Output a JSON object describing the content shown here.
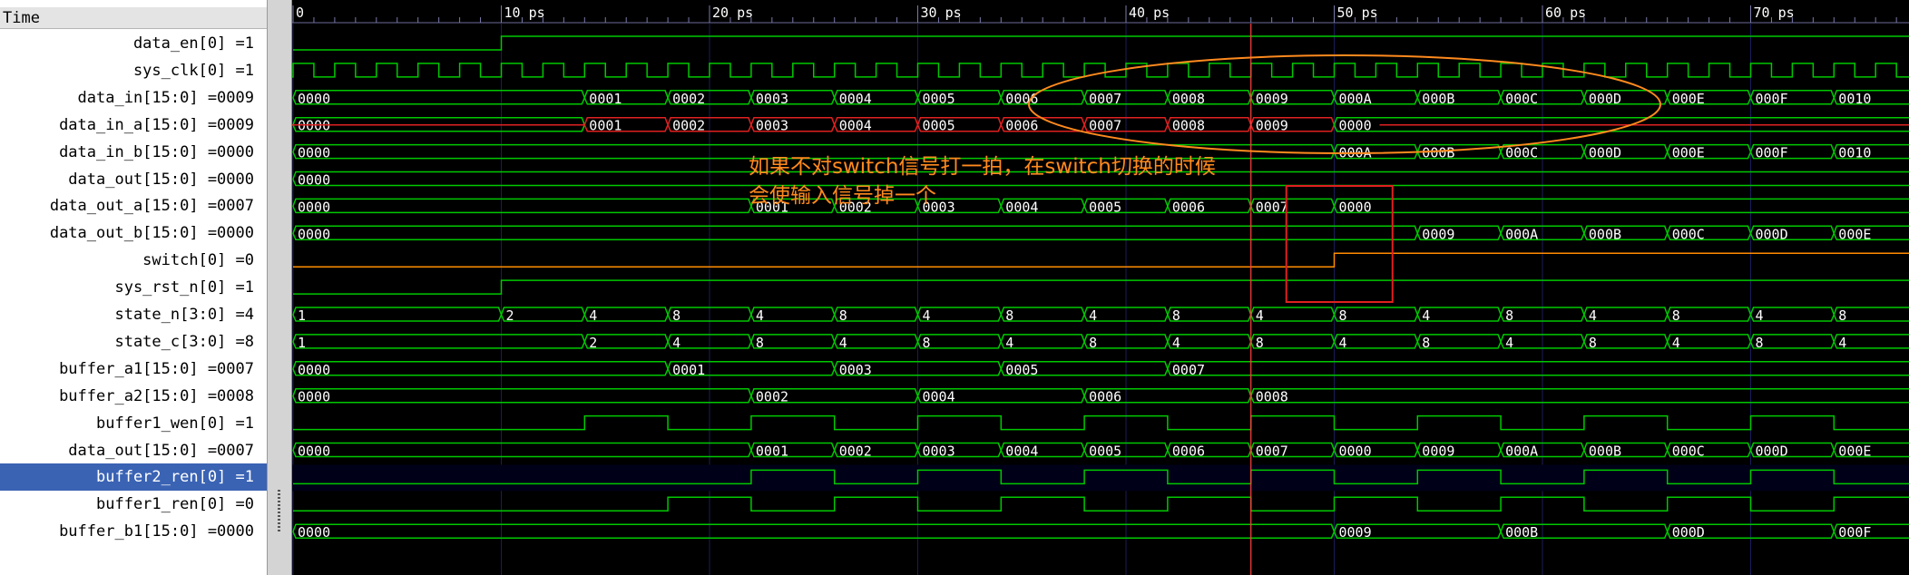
{
  "header": {
    "time_label": "Time"
  },
  "timescale": {
    "ticks": [
      {
        "value": 0,
        "label": "0"
      },
      {
        "value": 10,
        "label": "10 ps"
      },
      {
        "value": 20,
        "label": "20 ps"
      },
      {
        "value": 30,
        "label": "30 ps"
      },
      {
        "value": 40,
        "label": "40 ps"
      },
      {
        "value": 50,
        "label": "50 ps"
      },
      {
        "value": 60,
        "label": "60 ps"
      },
      {
        "value": 70,
        "label": "70 ps"
      }
    ],
    "cursor_time": 46
  },
  "colors": {
    "trace": "#00c800",
    "red_trace": "#e02020",
    "switch_trace": "#ff8c00",
    "cursor": "#ff4040",
    "annotation": "#ff8a1e",
    "selected_row": "#3a63b4"
  },
  "signals": [
    {
      "label": "data_en[0] =1",
      "kind": "bit",
      "transitions": [
        [
          0,
          0
        ],
        [
          10,
          1
        ]
      ]
    },
    {
      "label": "sys_clk[0] =1",
      "kind": "clock",
      "half_period": 1
    },
    {
      "label": "data_in[15:0] =0009",
      "kind": "bus",
      "segments": [
        [
          0,
          "0000"
        ],
        [
          14,
          "0001"
        ],
        [
          18,
          "0002"
        ],
        [
          22,
          "0003"
        ],
        [
          26,
          "0004"
        ],
        [
          30,
          "0005"
        ],
        [
          34,
          "0006"
        ],
        [
          38,
          "0007"
        ],
        [
          42,
          "0008"
        ],
        [
          46,
          "0009"
        ],
        [
          50,
          "000A"
        ],
        [
          54,
          "000B"
        ],
        [
          58,
          "000C"
        ],
        [
          62,
          "000D"
        ],
        [
          66,
          "000E"
        ],
        [
          70,
          "000F"
        ],
        [
          74,
          "0010"
        ]
      ]
    },
    {
      "label": "data_in_a[15:0] =0009",
      "kind": "bus",
      "red_until": 50,
      "segments": [
        [
          0,
          "0000"
        ],
        [
          14,
          "0001"
        ],
        [
          18,
          "0002"
        ],
        [
          22,
          "0003"
        ],
        [
          26,
          "0004"
        ],
        [
          30,
          "0005"
        ],
        [
          34,
          "0006"
        ],
        [
          38,
          "0007"
        ],
        [
          42,
          "0008"
        ],
        [
          46,
          "0009"
        ],
        [
          50,
          "0000"
        ]
      ]
    },
    {
      "label": "data_in_b[15:0] =0000",
      "kind": "bus",
      "segments": [
        [
          0,
          "0000"
        ],
        [
          50,
          "000A"
        ],
        [
          54,
          "000B"
        ],
        [
          58,
          "000C"
        ],
        [
          62,
          "000D"
        ],
        [
          66,
          "000E"
        ],
        [
          70,
          "000F"
        ],
        [
          74,
          "0010"
        ]
      ]
    },
    {
      "label": "data_out[15:0] =0000",
      "kind": "bus",
      "segments": [
        [
          0,
          "0000"
        ]
      ]
    },
    {
      "label": "data_out_a[15:0] =0007",
      "kind": "bus",
      "segments": [
        [
          0,
          "0000"
        ],
        [
          22,
          "0001"
        ],
        [
          26,
          "0002"
        ],
        [
          30,
          "0003"
        ],
        [
          34,
          "0004"
        ],
        [
          38,
          "0005"
        ],
        [
          42,
          "0006"
        ],
        [
          46,
          "0007"
        ],
        [
          50,
          "0000"
        ]
      ]
    },
    {
      "label": "data_out_b[15:0] =0000",
      "kind": "bus",
      "segments": [
        [
          0,
          "0000"
        ],
        [
          54,
          "0009"
        ],
        [
          58,
          "000A"
        ],
        [
          62,
          "000B"
        ],
        [
          66,
          "000C"
        ],
        [
          70,
          "000D"
        ],
        [
          74,
          "000E"
        ]
      ]
    },
    {
      "label": "switch[0] =0",
      "kind": "bit",
      "orange": true,
      "transitions": [
        [
          0,
          0
        ],
        [
          50,
          1
        ]
      ]
    },
    {
      "label": "sys_rst_n[0] =1",
      "kind": "bit",
      "transitions": [
        [
          0,
          0
        ],
        [
          10,
          1
        ]
      ]
    },
    {
      "label": "state_n[3:0] =4",
      "kind": "bus",
      "segments": [
        [
          0,
          "1"
        ],
        [
          10,
          "2"
        ],
        [
          14,
          "4"
        ],
        [
          18,
          "8"
        ],
        [
          22,
          "4"
        ],
        [
          26,
          "8"
        ],
        [
          30,
          "4"
        ],
        [
          34,
          "8"
        ],
        [
          38,
          "4"
        ],
        [
          42,
          "8"
        ],
        [
          46,
          "4"
        ],
        [
          50,
          "8"
        ],
        [
          54,
          "4"
        ],
        [
          58,
          "8"
        ],
        [
          62,
          "4"
        ],
        [
          66,
          "8"
        ],
        [
          70,
          "4"
        ],
        [
          74,
          "8"
        ]
      ]
    },
    {
      "label": "state_c[3:0] =8",
      "kind": "bus",
      "segments": [
        [
          0,
          "1"
        ],
        [
          14,
          "2"
        ],
        [
          18,
          "4"
        ],
        [
          22,
          "8"
        ],
        [
          26,
          "4"
        ],
        [
          30,
          "8"
        ],
        [
          34,
          "4"
        ],
        [
          38,
          "8"
        ],
        [
          42,
          "4"
        ],
        [
          46,
          "8"
        ],
        [
          50,
          "4"
        ],
        [
          54,
          "8"
        ],
        [
          58,
          "4"
        ],
        [
          62,
          "8"
        ],
        [
          66,
          "4"
        ],
        [
          70,
          "8"
        ],
        [
          74,
          "4"
        ]
      ]
    },
    {
      "label": "buffer_a1[15:0] =0007",
      "kind": "bus",
      "segments": [
        [
          0,
          "0000"
        ],
        [
          18,
          "0001"
        ],
        [
          26,
          "0003"
        ],
        [
          34,
          "0005"
        ],
        [
          42,
          "0007"
        ]
      ]
    },
    {
      "label": "buffer_a2[15:0] =0008",
      "kind": "bus",
      "segments": [
        [
          0,
          "0000"
        ],
        [
          22,
          "0002"
        ],
        [
          30,
          "0004"
        ],
        [
          38,
          "0006"
        ],
        [
          46,
          "0008"
        ]
      ]
    },
    {
      "label": "buffer1_wen[0] =1",
      "kind": "bit",
      "transitions": [
        [
          0,
          0
        ],
        [
          14,
          1
        ],
        [
          18,
          0
        ],
        [
          22,
          1
        ],
        [
          26,
          0
        ],
        [
          30,
          1
        ],
        [
          34,
          0
        ],
        [
          38,
          1
        ],
        [
          42,
          0
        ],
        [
          46,
          1
        ],
        [
          50,
          0
        ],
        [
          54,
          1
        ],
        [
          58,
          0
        ],
        [
          62,
          1
        ],
        [
          66,
          0
        ],
        [
          70,
          1
        ],
        [
          74,
          0
        ]
      ]
    },
    {
      "label": "data_out[15:0] =0007",
      "kind": "bus",
      "segments": [
        [
          0,
          "0000"
        ],
        [
          22,
          "0001"
        ],
        [
          26,
          "0002"
        ],
        [
          30,
          "0003"
        ],
        [
          34,
          "0004"
        ],
        [
          38,
          "0005"
        ],
        [
          42,
          "0006"
        ],
        [
          46,
          "0007"
        ],
        [
          50,
          "0000"
        ],
        [
          54,
          "0009"
        ],
        [
          58,
          "000A"
        ],
        [
          62,
          "000B"
        ],
        [
          66,
          "000C"
        ],
        [
          70,
          "000D"
        ],
        [
          74,
          "000E"
        ]
      ]
    },
    {
      "label": "buffer2_ren[0] =1",
      "kind": "bit",
      "selected": true,
      "transitions": [
        [
          0,
          0
        ],
        [
          22,
          1
        ],
        [
          26,
          0
        ],
        [
          30,
          1
        ],
        [
          34,
          0
        ],
        [
          38,
          1
        ],
        [
          42,
          0
        ],
        [
          46,
          1
        ],
        [
          50,
          0
        ],
        [
          54,
          1
        ],
        [
          58,
          0
        ],
        [
          62,
          1
        ],
        [
          66,
          0
        ],
        [
          70,
          1
        ],
        [
          74,
          0
        ]
      ]
    },
    {
      "label": "buffer1_ren[0] =0",
      "kind": "bit",
      "transitions": [
        [
          0,
          0
        ],
        [
          18,
          1
        ],
        [
          22,
          0
        ],
        [
          26,
          1
        ],
        [
          30,
          0
        ],
        [
          34,
          1
        ],
        [
          38,
          0
        ],
        [
          42,
          1
        ],
        [
          46,
          0
        ],
        [
          50,
          1
        ],
        [
          54,
          0
        ],
        [
          58,
          1
        ],
        [
          62,
          0
        ],
        [
          66,
          1
        ],
        [
          70,
          0
        ],
        [
          74,
          1
        ]
      ]
    },
    {
      "label": "buffer_b1[15:0] =0000",
      "kind": "bus",
      "segments": [
        [
          0,
          "0000"
        ],
        [
          50,
          "0009"
        ],
        [
          58,
          "000B"
        ],
        [
          66,
          "000D"
        ],
        [
          74,
          "000F"
        ]
      ]
    }
  ],
  "annotation": {
    "lines": [
      "如果不对switch信号打一拍，在switch切换的时候",
      "会使输入信号掉一个"
    ]
  }
}
